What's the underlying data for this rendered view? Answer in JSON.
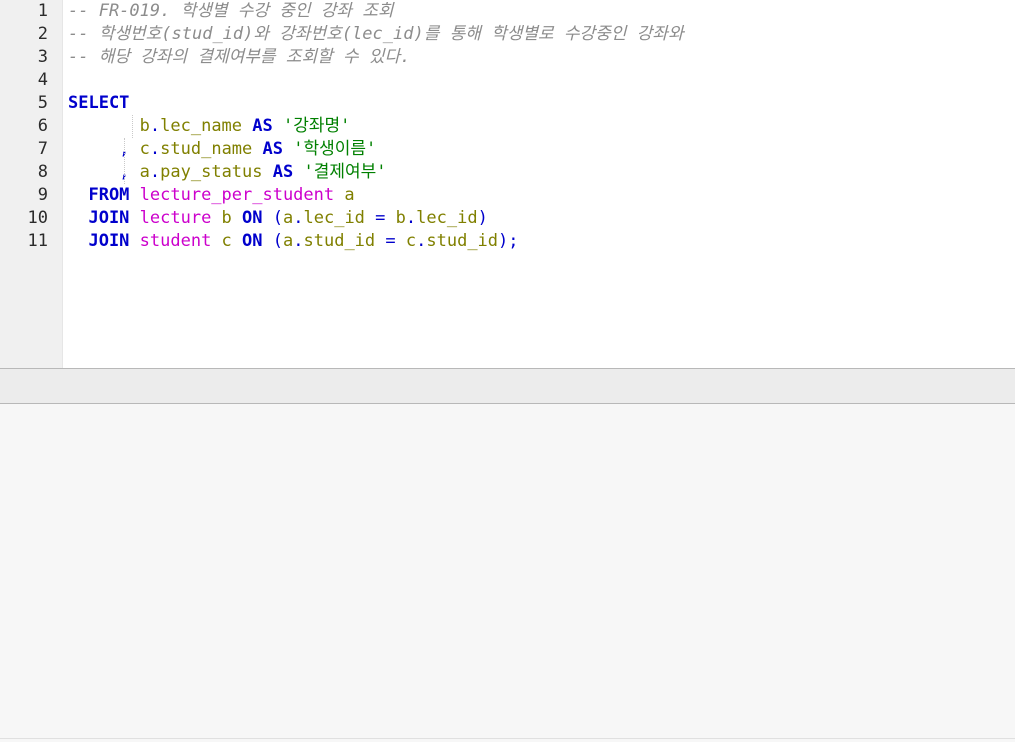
{
  "editor": {
    "lines": [
      {
        "num": "1",
        "parts": [
          {
            "t": "-- FR-019. 학생별 수강 중인 강좌 조회",
            "c": "cmt"
          }
        ]
      },
      {
        "num": "2",
        "parts": [
          {
            "t": "-- 학생번호(stud_id)와 강좌번호(lec_id)를 통해 학생별로 수강중인 강좌와",
            "c": "cmt"
          }
        ]
      },
      {
        "num": "3",
        "parts": [
          {
            "t": "-- 해당 강좌의 결제여부를 조회할 수 있다.",
            "c": "cmt"
          }
        ]
      },
      {
        "num": "4",
        "parts": []
      },
      {
        "num": "5",
        "parts": [
          {
            "t": "SELECT",
            "c": "kw"
          }
        ]
      },
      {
        "num": "6",
        "parts": [
          {
            "t": "       b",
            "c": "id"
          },
          {
            "t": ".",
            "c": "op"
          },
          {
            "t": "lec_name ",
            "c": "id"
          },
          {
            "t": "AS",
            "c": "kw"
          },
          {
            "t": " '강좌명'",
            "c": "str"
          }
        ]
      },
      {
        "num": "7",
        "parts": [
          {
            "t": "     , ",
            "c": "op"
          },
          {
            "t": "c",
            "c": "id"
          },
          {
            "t": ".",
            "c": "op"
          },
          {
            "t": "stud_name ",
            "c": "id"
          },
          {
            "t": "AS",
            "c": "kw"
          },
          {
            "t": " '학생이름'",
            "c": "str"
          }
        ]
      },
      {
        "num": "8",
        "parts": [
          {
            "t": "     , ",
            "c": "op"
          },
          {
            "t": "a",
            "c": "id"
          },
          {
            "t": ".",
            "c": "op"
          },
          {
            "t": "pay_status ",
            "c": "id"
          },
          {
            "t": "AS",
            "c": "kw"
          },
          {
            "t": " '결제여부'",
            "c": "str"
          }
        ]
      },
      {
        "num": "9",
        "parts": [
          {
            "t": "  FROM ",
            "c": "kw"
          },
          {
            "t": "lecture_per_student ",
            "c": "tbl"
          },
          {
            "t": "a",
            "c": "id"
          }
        ]
      },
      {
        "num": "10",
        "parts": [
          {
            "t": "  JOIN ",
            "c": "kw"
          },
          {
            "t": "lecture ",
            "c": "tbl"
          },
          {
            "t": "b ",
            "c": "id"
          },
          {
            "t": "ON",
            "c": "kw"
          },
          {
            "t": " (",
            "c": "op"
          },
          {
            "t": "a",
            "c": "id"
          },
          {
            "t": ".",
            "c": "op"
          },
          {
            "t": "lec_id ",
            "c": "id"
          },
          {
            "t": "= ",
            "c": "op"
          },
          {
            "t": "b",
            "c": "id"
          },
          {
            "t": ".",
            "c": "op"
          },
          {
            "t": "lec_id",
            "c": "id"
          },
          {
            "t": ")",
            "c": "op"
          }
        ]
      },
      {
        "num": "11",
        "parts": [
          {
            "t": "  JOIN ",
            "c": "kw"
          },
          {
            "t": "student ",
            "c": "tbl"
          },
          {
            "t": "c ",
            "c": "id"
          },
          {
            "t": "ON",
            "c": "kw"
          },
          {
            "t": " (",
            "c": "op"
          },
          {
            "t": "a",
            "c": "id"
          },
          {
            "t": ".",
            "c": "op"
          },
          {
            "t": "stud_id ",
            "c": "id"
          },
          {
            "t": "= ",
            "c": "op"
          },
          {
            "t": "c",
            "c": "id"
          },
          {
            "t": ".",
            "c": "op"
          },
          {
            "t": "stud_id",
            "c": "id"
          },
          {
            "t": ");",
            "c": "op"
          }
        ]
      }
    ]
  },
  "colors": {
    "keyword": "#0000cc",
    "identifier": "#808000",
    "string": "#008000",
    "table": "#cc00cc",
    "comment": "#8c8c8c"
  }
}
